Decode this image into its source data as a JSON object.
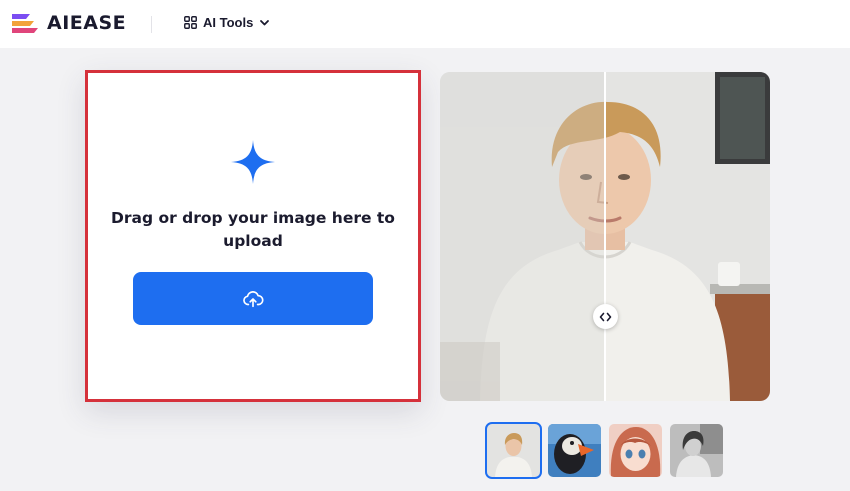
{
  "header": {
    "brand": "AIEASE",
    "logo_icon": "aiease-logo-icon",
    "ai_tools_label": "AI Tools"
  },
  "upload": {
    "instruction": "Drag or drop your image here to upload",
    "plus_icon": "plus-sparkle-icon",
    "button_icon": "cloud-upload-icon",
    "accent_color": "#1e6ef0",
    "highlight_border_color": "#d5313b"
  },
  "preview": {
    "compare_handle_icon": "left-right-arrows-icon",
    "samples": [
      {
        "name": "portrait-man",
        "selected": true
      },
      {
        "name": "puffin",
        "selected": false
      },
      {
        "name": "anime-girl",
        "selected": false
      },
      {
        "name": "bw-woman",
        "selected": false
      }
    ]
  }
}
